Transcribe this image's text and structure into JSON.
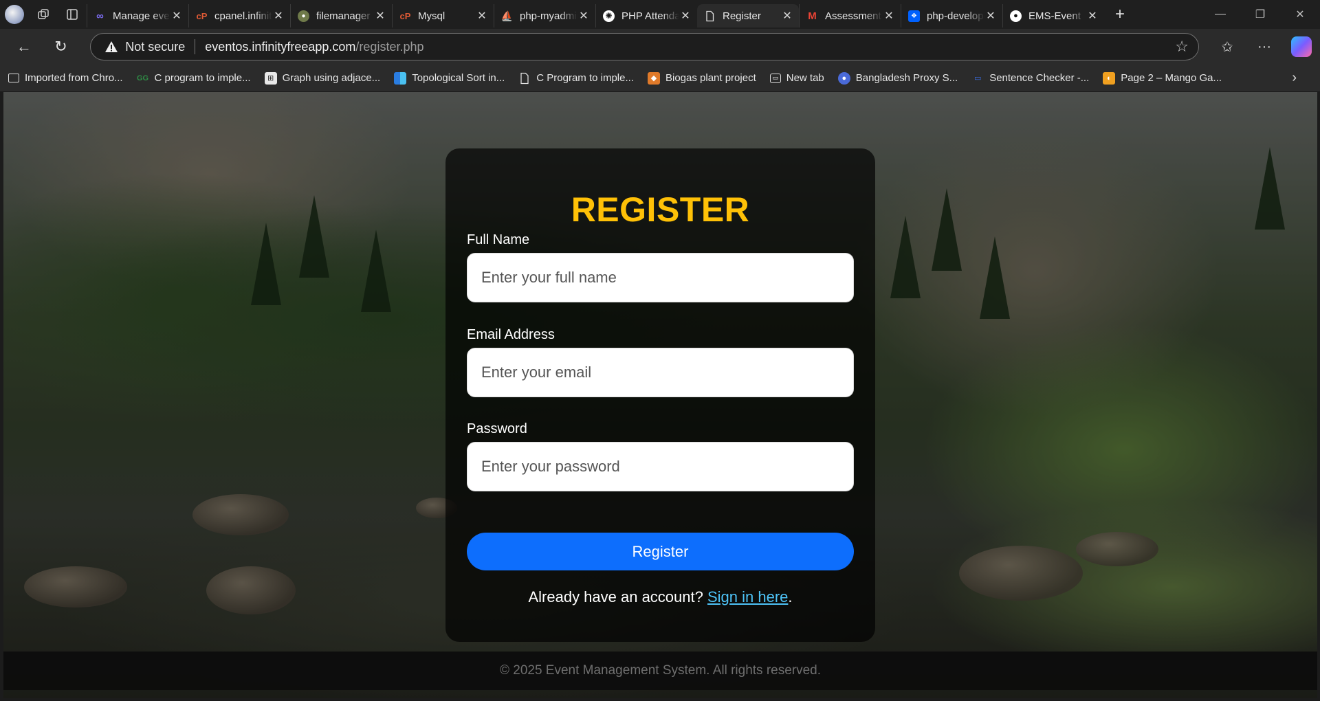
{
  "browser": {
    "tabs": [
      {
        "title": "Manage events",
        "icon": "infinity-icon",
        "color": "#5b4bd6"
      },
      {
        "title": "cpanel.infinityfree",
        "icon": "cpanel-icon",
        "color": "#c0462a"
      },
      {
        "title": "filemanager",
        "icon": "file-manager-icon",
        "color": "#7a8a52"
      },
      {
        "title": "Mysql",
        "icon": "cpanel-icon",
        "color": "#c0462a"
      },
      {
        "title": "php-myadmin",
        "icon": "phpmyadmin-icon",
        "color": "#d48a2a"
      },
      {
        "title": "PHP Attendance",
        "icon": "chatgpt-icon",
        "color": "#444444"
      },
      {
        "title": "Register",
        "icon": "page-icon",
        "color": "#2b2b2b",
        "active": true
      },
      {
        "title": "Assessment",
        "icon": "gmail-icon",
        "color": "#d93025"
      },
      {
        "title": "php-developer",
        "icon": "dropbox-icon",
        "color": "#0061fe"
      },
      {
        "title": "EMS-Event",
        "icon": "github-icon",
        "color": "#222222"
      }
    ],
    "address": {
      "security_label": "Not secure",
      "host": "eventos.infinityfreeapp.com",
      "path": "/register.php"
    },
    "bookmarks": [
      {
        "label": "Imported from Chro...",
        "icon": "folder-icon"
      },
      {
        "label": "C program to imple...",
        "icon": "geeksforgeeks-icon"
      },
      {
        "label": "Graph using adjace...",
        "icon": "graph-icon"
      },
      {
        "label": "Topological Sort in...",
        "icon": "grid-icon"
      },
      {
        "label": "C Program to imple...",
        "icon": "page-icon"
      },
      {
        "label": "Biogas plant project",
        "icon": "biogas-icon"
      },
      {
        "label": "New tab",
        "icon": "newtab-icon"
      },
      {
        "label": "Bangladesh Proxy S...",
        "icon": "proxy-icon"
      },
      {
        "label": "Sentence Checker -...",
        "icon": "checker-icon"
      },
      {
        "label": "Page 2 – Mango Ga...",
        "icon": "mango-icon"
      }
    ]
  },
  "page": {
    "title": "REGISTER",
    "fields": {
      "name": {
        "label": "Full Name",
        "placeholder": "Enter your full name",
        "value": ""
      },
      "email": {
        "label": "Email Address",
        "placeholder": "Enter your email",
        "value": ""
      },
      "password": {
        "label": "Password",
        "placeholder": "Enter your password",
        "value": ""
      }
    },
    "submit_label": "Register",
    "signin": {
      "prefix": "Already have an account? ",
      "link_text": "Sign in here",
      "suffix": "."
    },
    "footer": "© 2025 Event Management System. All rights reserved.",
    "colors": {
      "title": "#ffc107",
      "button": "#0d6efd",
      "link": "#4ec3f7"
    }
  }
}
